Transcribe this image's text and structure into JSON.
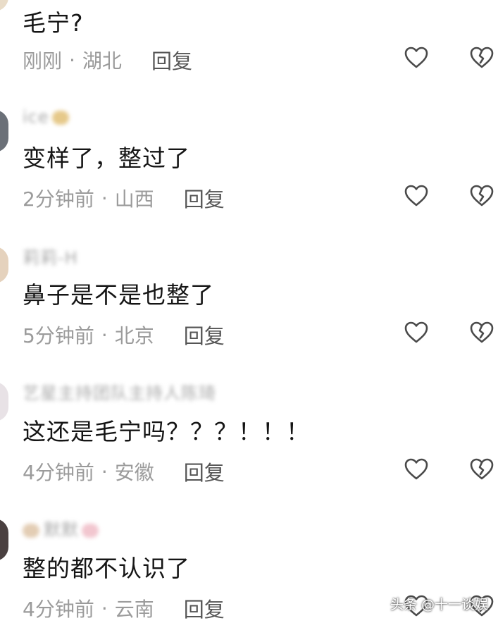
{
  "comments": [
    {
      "username": "",
      "text": "毛宁?",
      "time": "刚刚",
      "location": "湖北",
      "reply_label": "回复"
    },
    {
      "username": "ice",
      "text": "变样了，整过了",
      "time": "2分钟前",
      "location": "山西",
      "reply_label": "回复"
    },
    {
      "username": "莉莉-H",
      "text": "鼻子是不是也整了",
      "time": "5分钟前",
      "location": "北京",
      "reply_label": "回复"
    },
    {
      "username": "艺星主持团队主持人陈琦",
      "text": "这还是毛宁吗？？？！！！",
      "time": "4分钟前",
      "location": "安徽",
      "reply_label": "回复"
    },
    {
      "username": "默默",
      "text": "整的都不认识了",
      "time": "4分钟前",
      "location": "云南",
      "reply_label": "回复"
    }
  ],
  "separator": "·",
  "watermark": "头条 @十一谈娱",
  "icons": {
    "like": "heart-outline-icon",
    "dislike": "broken-heart-icon"
  },
  "colors": {
    "text": "#151515",
    "meta": "#9b9b9b",
    "icon": "#4a4a4a"
  }
}
